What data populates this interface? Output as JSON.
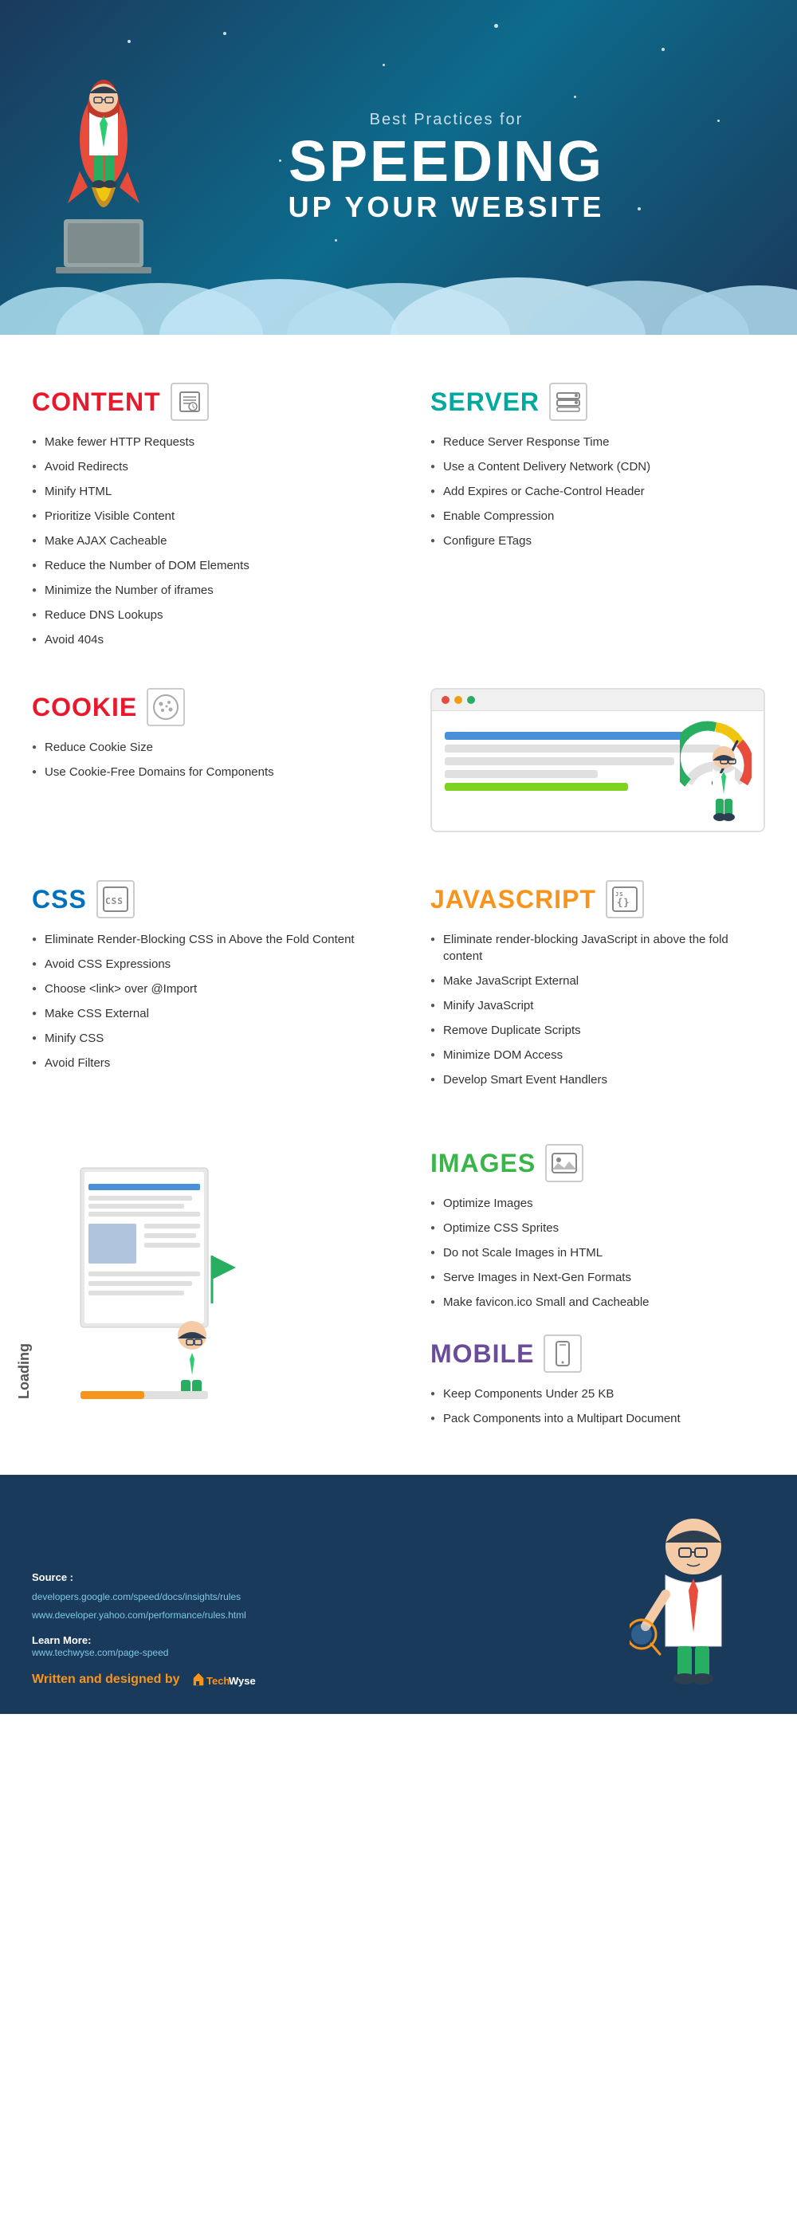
{
  "header": {
    "subtitle": "Best Practices for",
    "main_title": "SPEEDING",
    "subtitle2": "UP YOUR WEBSITE"
  },
  "content_section": {
    "title": "CONTENT",
    "items": [
      "Make fewer HTTP Requests",
      "Avoid Redirects",
      "Minify HTML",
      "Prioritize Visible Content",
      "Make AJAX Cacheable",
      "Reduce the Number of DOM Elements",
      "Minimize the Number of iframes",
      "Reduce DNS Lookups",
      "Avoid 404s"
    ]
  },
  "server_section": {
    "title": "SERVER",
    "items": [
      "Reduce Server Response Time",
      "Use a Content Delivery Network (CDN)",
      "Add Expires or Cache-Control Header",
      "Enable Compression",
      "Configure ETags"
    ]
  },
  "cookie_section": {
    "title": "COOKIE",
    "items": [
      "Reduce Cookie Size",
      "Use Cookie-Free Domains for Components"
    ]
  },
  "css_section": {
    "title": "CSS",
    "items": [
      "Eliminate Render-Blocking CSS in Above the Fold Content",
      "Avoid CSS Expressions",
      "Choose <link> over @Import",
      "Make CSS External",
      "Minify CSS",
      "Avoid Filters"
    ]
  },
  "javascript_section": {
    "title": "JAVASCRIPT",
    "items": [
      "Eliminate render-blocking JavaScript in above the fold content",
      "Make JavaScript External",
      "Minify JavaScript",
      "Remove Duplicate Scripts",
      "Minimize DOM Access",
      "Develop Smart Event Handlers"
    ]
  },
  "images_section": {
    "title": "IMAGES",
    "items": [
      "Optimize Images",
      "Optimize CSS Sprites",
      "Do not Scale Images in HTML",
      "Serve Images in Next-Gen Formats",
      "Make favicon.ico Small and Cacheable"
    ]
  },
  "mobile_section": {
    "title": "MOBILE",
    "items": [
      "Keep Components Under 25 KB",
      "Pack Components into a Multipart Document"
    ]
  },
  "loading_label": "Loading",
  "footer": {
    "source_label": "Source :",
    "source_links": [
      "developers.google.com/speed/docs/insights/rules",
      "www.developer.yahoo.com/performance/rules.html"
    ],
    "learn_label": "Learn More:",
    "learn_link": "www.techwyse.com/page-speed",
    "brand_prefix": "Written and designed by",
    "brand_name": "TechWyse"
  }
}
